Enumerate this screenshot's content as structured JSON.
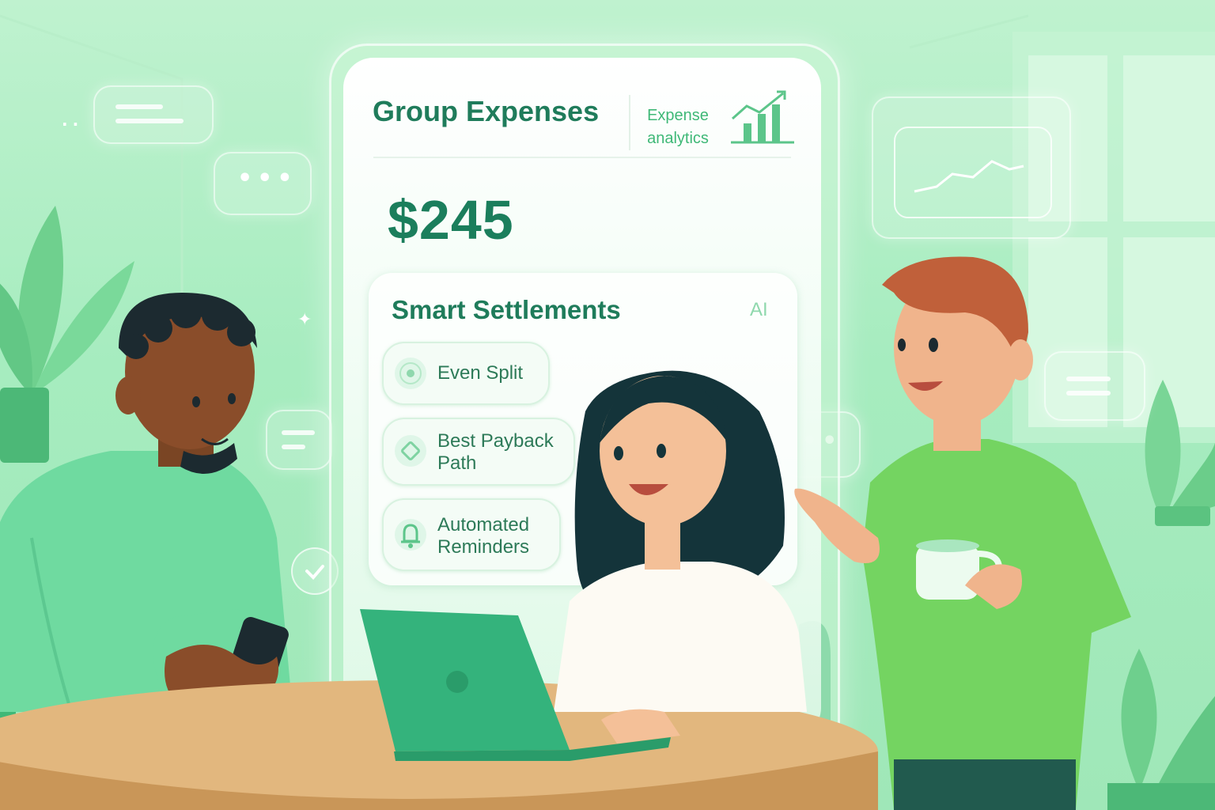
{
  "card": {
    "title": "Group Expenses",
    "analytics_label": "Expense analytics",
    "amount": "$245",
    "settlements": {
      "title": "Smart Settlements",
      "badge": "AI",
      "options": [
        {
          "label_line1": "Even Split",
          "label_line2": "",
          "icon": "radio-circle-icon"
        },
        {
          "label_line1": "Best Payback",
          "label_line2": "Path",
          "icon": "route-diamond-icon"
        },
        {
          "label_line1": "Automated",
          "label_line2": "Reminders",
          "icon": "bell-icon"
        }
      ]
    }
  },
  "colors": {
    "background": "#a6ecbf",
    "primary_text": "#1f7c5b",
    "accent": "#3fb877",
    "table": "#e2b77e",
    "laptop": "#34b37c"
  }
}
